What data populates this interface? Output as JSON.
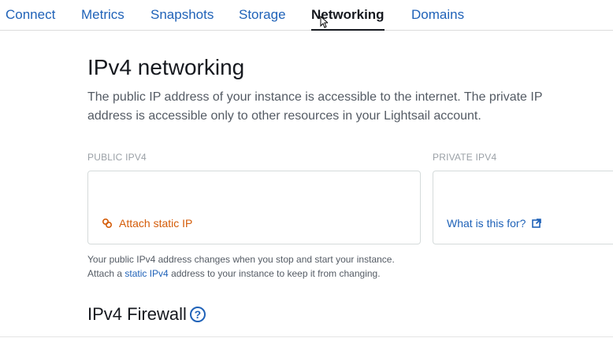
{
  "tabs": [
    {
      "label": "Connect"
    },
    {
      "label": "Metrics"
    },
    {
      "label": "Snapshots"
    },
    {
      "label": "Storage"
    },
    {
      "label": "Networking"
    },
    {
      "label": "Domains"
    }
  ],
  "ipv4": {
    "title": "IPv4 networking",
    "description": "The public IP address of your instance is accessible to the internet. The private IP address is accessible only to other resources in your Lightsail account.",
    "public": {
      "label": "PUBLIC IPV4",
      "value_masked": "",
      "attach_link": "Attach static IP"
    },
    "private": {
      "label": "PRIVATE IPV4",
      "value_masked": "",
      "help_link": "What is this for?"
    },
    "note": {
      "line1": "Your public IPv4 address changes when you stop and start your instance.",
      "line2_prefix": "Attach a ",
      "line2_link": "static IPv4",
      "line2_suffix": " address to your instance to keep it from changing."
    }
  },
  "firewall": {
    "title": "IPv4 Firewall",
    "help_icon": "?"
  },
  "colors": {
    "link": "#1f62b8",
    "attach": "#d45b07",
    "text": "#16191f",
    "muted": "#545b64"
  }
}
